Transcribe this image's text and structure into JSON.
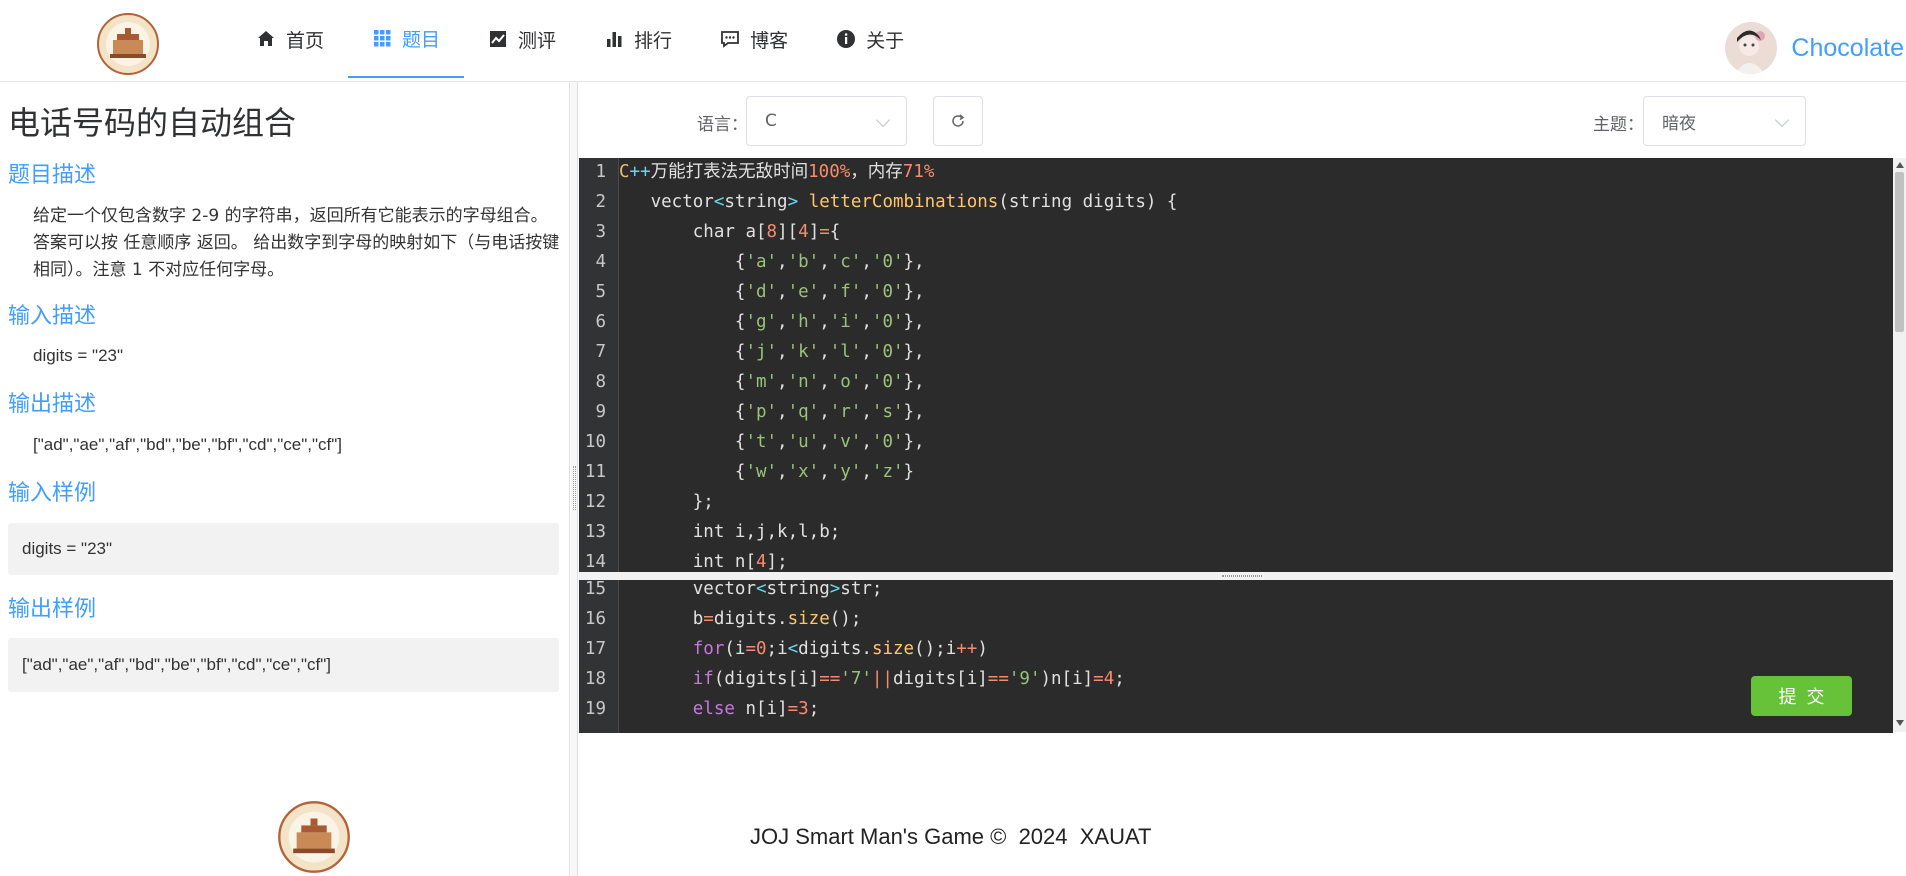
{
  "header": {
    "nav": [
      {
        "label": "首页",
        "icon": "home-icon"
      },
      {
        "label": "题目",
        "icon": "grid-icon",
        "active": true
      },
      {
        "label": "测评",
        "icon": "chart-line-icon"
      },
      {
        "label": "排行",
        "icon": "bar-chart-icon"
      },
      {
        "label": "博客",
        "icon": "chat-icon"
      },
      {
        "label": "关于",
        "icon": "info-icon"
      }
    ],
    "username": "Chocolate"
  },
  "problem": {
    "title": "电话号码的自动组合",
    "desc_heading": "题目描述",
    "desc_text": "给定一个仅包含数字 2-9 的字符串，返回所有它能表示的字母组合。答案可以按 任意顺序 返回。 给出数字到字母的映射如下（与电话按键相同）。注意 1 不对应任何字母。",
    "input_heading": "输入描述",
    "input_text": "digits = \"23\"",
    "output_heading": "输出描述",
    "output_text": "[\"ad\",\"ae\",\"af\",\"bd\",\"be\",\"bf\",\"cd\",\"ce\",\"cf\"]",
    "input_sample_heading": "输入样例",
    "input_sample": "digits = \"23\"",
    "output_sample_heading": "输出样例",
    "output_sample": "[\"ad\",\"ae\",\"af\",\"bd\",\"be\",\"bf\",\"cd\",\"ce\",\"cf\"]"
  },
  "editor": {
    "language_label": "语言：",
    "language_value": "C",
    "theme_label": "主题：",
    "theme_value": "暗夜",
    "submit_label": "提交",
    "upper_lines": [
      {
        "n": "1",
        "text": "C++万能打表法无敌时间100%，内存71%"
      },
      {
        "n": "2",
        "text": "   vector<string> letterCombinations(string digits) {"
      },
      {
        "n": "3",
        "text": "       char a[8][4]={"
      },
      {
        "n": "4",
        "text": "           {'a','b','c','0'},"
      },
      {
        "n": "5",
        "text": "           {'d','e','f','0'},"
      },
      {
        "n": "6",
        "text": "           {'g','h','i','0'},"
      },
      {
        "n": "7",
        "text": "           {'j','k','l','0'},"
      },
      {
        "n": "8",
        "text": "           {'m','n','o','0'},"
      },
      {
        "n": "9",
        "text": "           {'p','q','r','s'},"
      },
      {
        "n": "10",
        "text": "           {'t','u','v','0'},"
      },
      {
        "n": "11",
        "text": "           {'w','x','y','z'}"
      },
      {
        "n": "12",
        "text": "       };"
      },
      {
        "n": "13",
        "text": "       int i,j,k,l,b;"
      },
      {
        "n": "14",
        "text": "       int n[4];"
      }
    ],
    "lower_lines": [
      {
        "n": "15",
        "text": "       vector<string>str;"
      },
      {
        "n": "16",
        "text": "       b=digits.size();"
      },
      {
        "n": "17",
        "text": "       for(i=0;i<digits.size();i++)"
      },
      {
        "n": "18",
        "text": "       if(digits[i]=='7'||digits[i]=='9')n[i]=4;"
      },
      {
        "n": "19",
        "text": "       else n[i]=3;"
      }
    ]
  },
  "footer": {
    "text": "JOJ Smart Man's Game ©  2024  XAUAT"
  },
  "colors": {
    "accent": "#409eff",
    "submit": "#67c23a",
    "editor_bg": "#2b2b2b"
  }
}
